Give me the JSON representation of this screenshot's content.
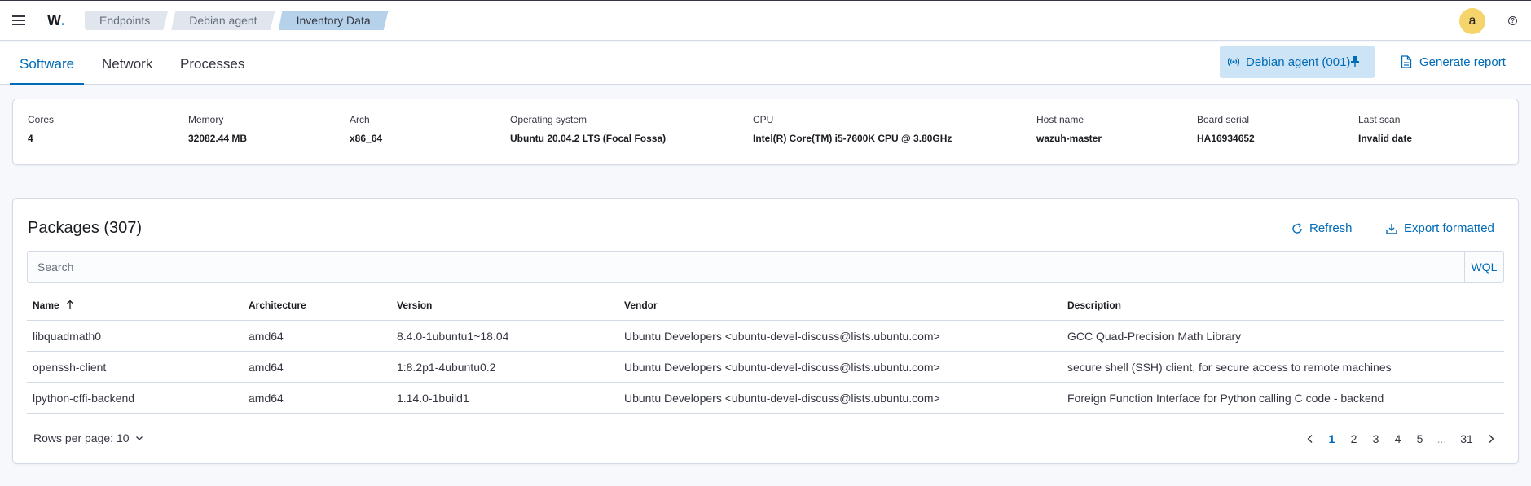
{
  "header": {
    "logo_text": "W",
    "breadcrumbs": [
      "Endpoints",
      "Debian agent",
      "Inventory Data"
    ],
    "avatar_letter": "a"
  },
  "tabs": [
    "Software",
    "Network",
    "Processes"
  ],
  "agent_button_label": "Debian agent (001)",
  "generate_report_label": "Generate report",
  "stats": [
    {
      "label": "Cores",
      "value": "4"
    },
    {
      "label": "Memory",
      "value": "32082.44 MB"
    },
    {
      "label": "Arch",
      "value": "x86_64"
    },
    {
      "label": "Operating system",
      "value": "Ubuntu 20.04.2 LTS (Focal Fossa)"
    },
    {
      "label": "CPU",
      "value": "Intel(R) Core(TM) i5-7600K CPU @ 3.80GHz"
    },
    {
      "label": "Host name",
      "value": "wazuh-master"
    },
    {
      "label": "Board serial",
      "value": "HA16934652"
    },
    {
      "label": "Last scan",
      "value": "Invalid date"
    }
  ],
  "packages": {
    "title": "Packages (307)",
    "refresh_label": "Refresh",
    "export_label": "Export formatted",
    "search_placeholder": "Search",
    "wql_label": "WQL",
    "columns": [
      "Name",
      "Architecture",
      "Version",
      "Vendor",
      "Description"
    ],
    "rows": [
      [
        "libquadmath0",
        "amd64",
        "8.4.0-1ubuntu1~18.04",
        "Ubuntu Developers <ubuntu-devel-discuss@lists.ubuntu.com>",
        "GCC Quad-Precision Math Library"
      ],
      [
        "openssh-client",
        "amd64",
        "1:8.2p1-4ubuntu0.2",
        "Ubuntu Developers <ubuntu-devel-discuss@lists.ubuntu.com>",
        "secure shell (SSH) client, for secure access to remote machines"
      ],
      [
        "lpython-cffi-backend",
        "amd64",
        "1.14.0-1build1",
        "Ubuntu Developers <ubuntu-devel-discuss@lists.ubuntu.com>",
        "Foreign Function Interface for Python calling C code - backend"
      ]
    ],
    "rows_per_page_label": "Rows per page: 10",
    "pages": [
      "1",
      "2",
      "3",
      "4",
      "5",
      "...",
      "31"
    ],
    "current_page": "1"
  },
  "colors": {
    "accent": "#006bb8",
    "agent_button_bg": "#cce4f5",
    "avatar_bg": "#f5d46b",
    "breadcrumb_active_bg": "#b6d2ea"
  }
}
